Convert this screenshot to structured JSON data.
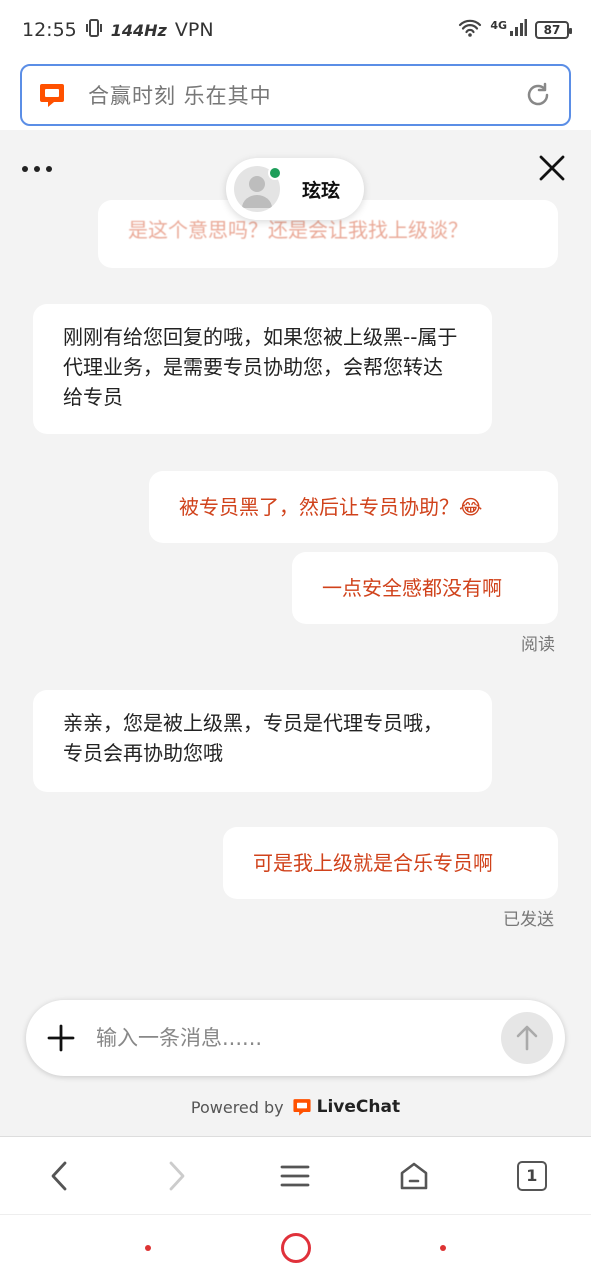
{
  "status_bar": {
    "time": "12:55",
    "refresh_rate": "144Hz",
    "vpn": "VPN",
    "network": "4G",
    "battery": "87"
  },
  "browser": {
    "url_text": "合赢时刻 乐在其中",
    "tab_count": "1"
  },
  "agent": {
    "name": "玹玹",
    "online": true
  },
  "messages": [
    {
      "direction": "out",
      "text": "是这个意思吗？还是会让我找上级谈？",
      "faded": true
    },
    {
      "direction": "in",
      "text": "刚刚有给您回复的哦，如果您被上级黑--属于代理业务，是需要专员协助您，会帮您转达给专员"
    },
    {
      "direction": "out",
      "text": "被专员黑了，然后让专员协助？😂"
    },
    {
      "direction": "out",
      "text": "一点安全感都没有啊",
      "status": "阅读"
    },
    {
      "direction": "in",
      "text": "亲亲，您是被上级黑，专员是代理专员哦，专员会再协助您哦"
    },
    {
      "direction": "out",
      "text": "可是我上级就是合乐专员啊",
      "status": "已发送"
    }
  ],
  "composer": {
    "placeholder": "输入一条消息......"
  },
  "powered": {
    "label": "Powered by",
    "brand": "LiveChat"
  },
  "colors": {
    "accent": "#FF5100",
    "outgoing_text": "#d0421b",
    "online": "#1e9e5a"
  }
}
